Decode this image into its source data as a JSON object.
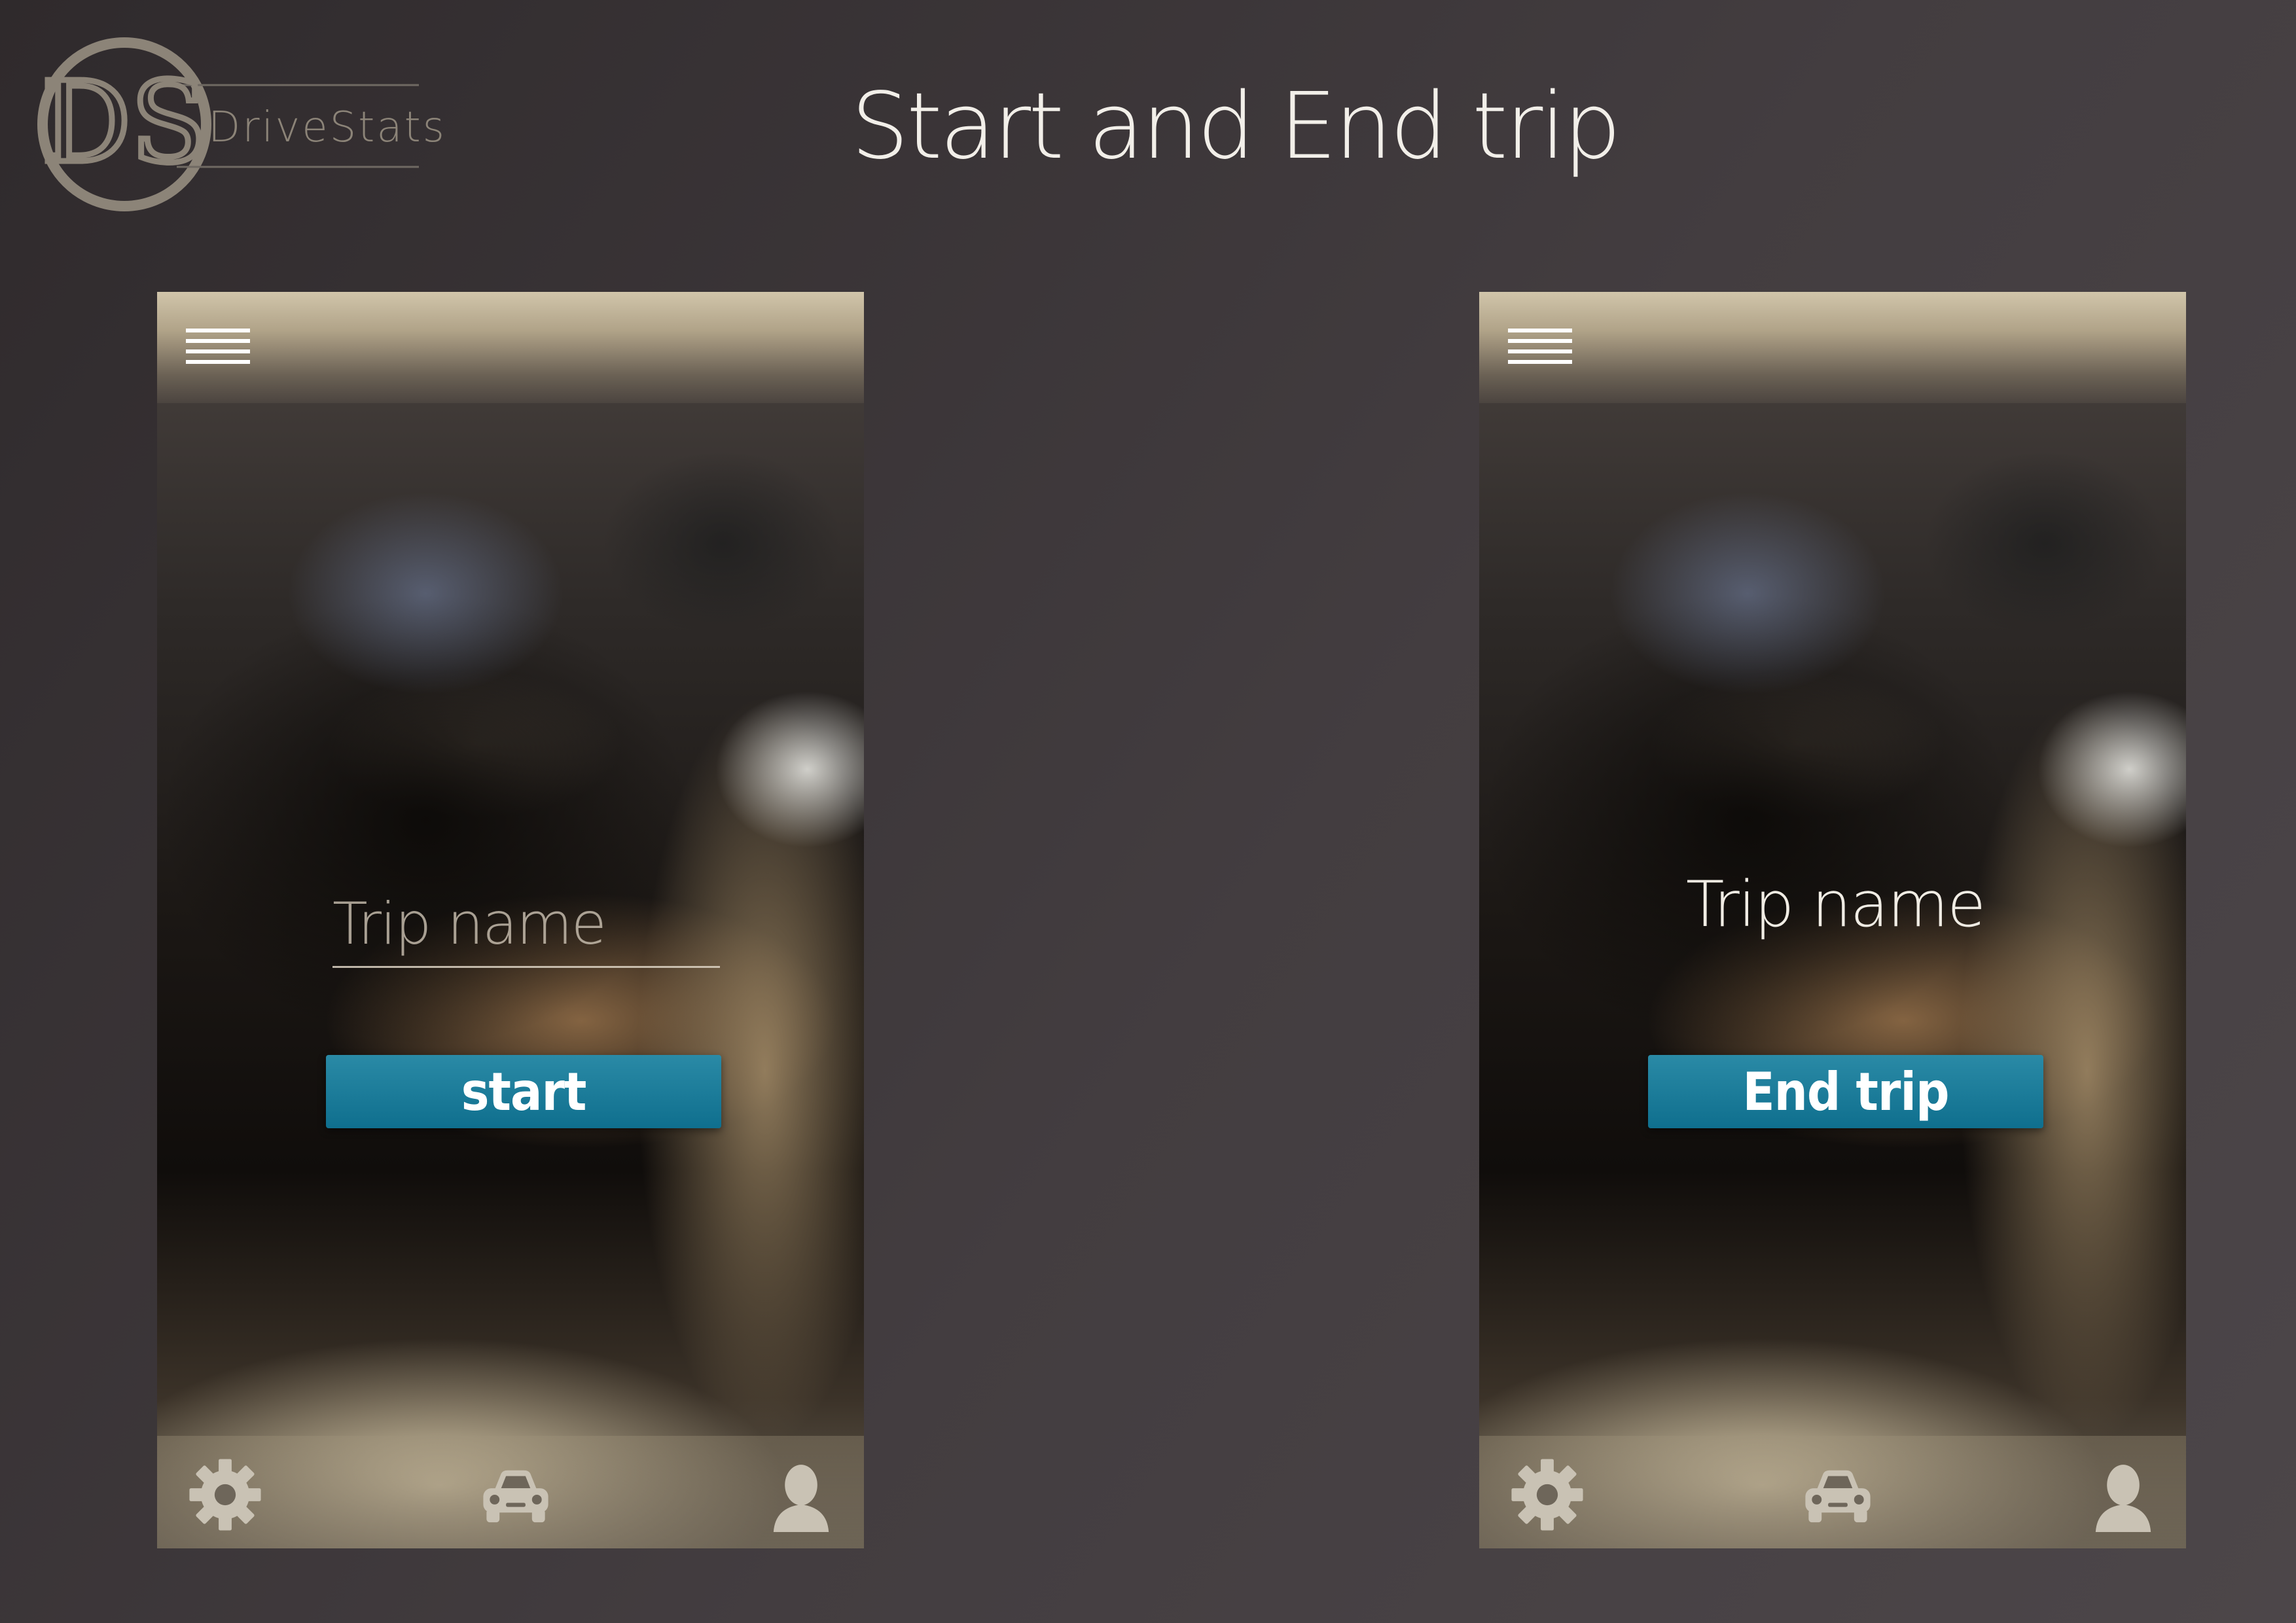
{
  "brand": {
    "logo_monogram": "DS",
    "name": "DriveStats"
  },
  "page_title": "Start and End trip",
  "screens": [
    {
      "trip_input": {
        "placeholder": "Trip name",
        "value": ""
      },
      "action_button": "start",
      "tabs": [
        {
          "icon": "gear-icon"
        },
        {
          "icon": "car-icon"
        },
        {
          "icon": "user-icon"
        }
      ]
    },
    {
      "trip_label": "Trip name",
      "action_button": "End trip",
      "tabs": [
        {
          "icon": "gear-icon"
        },
        {
          "icon": "car-icon"
        },
        {
          "icon": "user-icon"
        }
      ]
    }
  ],
  "colors": {
    "button": "#0f6f8e",
    "icon": "#c9c2b4",
    "logo": "#8c8478"
  }
}
